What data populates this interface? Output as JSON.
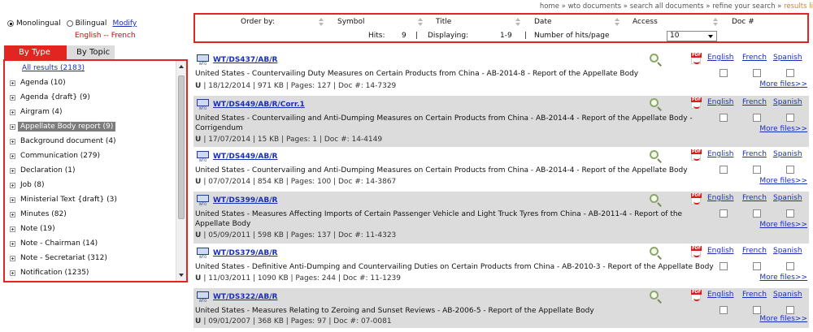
{
  "breadcrumb": [
    "home",
    "wto documents",
    "search all documents",
    "refine your search",
    "results li"
  ],
  "language": {
    "monolingual": "Monolingual",
    "bilingual": "Bilingual",
    "modify": "Modify",
    "pair": "English -- French"
  },
  "tabs": {
    "by_type": "By Type",
    "by_topic": "By Topic"
  },
  "types": [
    "All results (2183)",
    "Agenda (10)",
    "Agenda {draft} (9)",
    "Airgram (4)",
    "Appellate Body report (9)",
    "Background document (4)",
    "Communication (279)",
    "Declaration (1)",
    "Job (8)",
    "Ministerial Text {draft} (3)",
    "Minutes (82)",
    "Note (19)",
    "Note - Chairman (14)",
    "Note - Secretariat (312)",
    "Notification (1235)"
  ],
  "sort": {
    "order_by": "Order by:",
    "columns": [
      "Symbol",
      "Title",
      "Date",
      "Access",
      "Doc #"
    ]
  },
  "stats": {
    "hits_label": "Hits:",
    "hits": "9",
    "displaying_label": "Displaying:",
    "displaying": "1-9",
    "per_page_label": "Number of hits/page",
    "per_page": "10"
  },
  "links": {
    "english": "English",
    "french": "French",
    "spanish": "Spanish",
    "more": "More files>>"
  },
  "results": [
    {
      "symbol": "WT/DS437/AB/R",
      "title": "United States - Countervailing Duty Measures on Certain Products from China - AB-2014-8 - Report of the Appellate Body",
      "meta": "|  18/12/2014  |  971 KB  |  Pages: 127  |  Doc #: 14-7329"
    },
    {
      "symbol": "WT/DS449/AB/R/Corr.1",
      "title": "United States - Countervailing and Anti-Dumping Measures on Certain Products from China - AB-2014-4 - Report of the Appellate Body - Corrigendum",
      "meta": "|  17/07/2014  |  15 KB  |  Pages: 1  |  Doc #: 14-4149"
    },
    {
      "symbol": "WT/DS449/AB/R",
      "title": "United States - Countervailing and Anti-Dumping Measures on Certain Products from China - AB-2014-4 - Report of the Appellate Body",
      "meta": "|  07/07/2014  |  854 KB  |  Pages: 100  |  Doc #: 14-3867"
    },
    {
      "symbol": "WT/DS399/AB/R",
      "title": "United States - Measures Affecting Imports of Certain Passenger Vehicle and Light Truck Tyres from China - AB-2011-4 - Report of the Appellate Body",
      "meta": "|  05/09/2011  |  598 KB  |  Pages: 137  |  Doc #: 11-4323"
    },
    {
      "symbol": "WT/DS379/AB/R",
      "title": "United States - Definitive Anti-Dumping and Countervailing Duties on Certain Products from China - AB-2010-3 - Report of the Appellate Body",
      "meta": "|  11/03/2011  |  1090 KB  |  Pages: 244  |  Doc #: 11-1239"
    },
    {
      "symbol": "WT/DS322/AB/R",
      "title": "United States - Measures Relating to Zeroing and Sunset Reviews - AB-2006-5 - Report of the Appellate Body",
      "meta": "|  09/01/2007  |  368 KB  |  Pages: 97  |  Doc #: 07-0081"
    }
  ],
  "lang_code": "U",
  "icon_label": "WTO",
  "pdf_label": "PDF"
}
